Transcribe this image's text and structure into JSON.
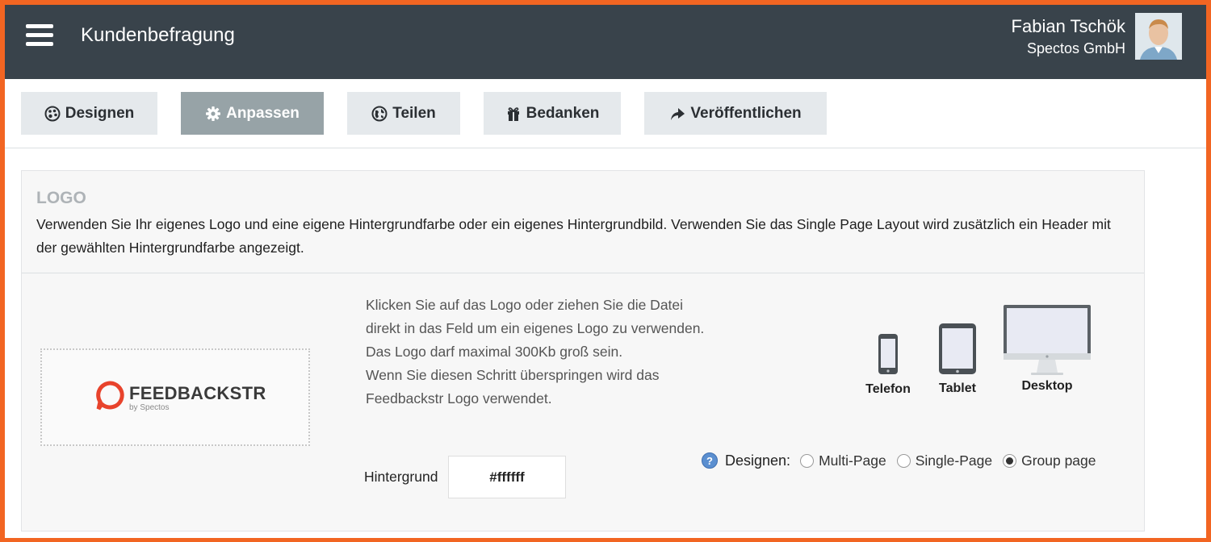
{
  "header": {
    "app_title": "Kundenbefragung",
    "user_name": "Fabian Tschök",
    "user_company": "Spectos GmbH"
  },
  "tabs": [
    {
      "label": "Designen",
      "icon": "palette-icon",
      "active": false
    },
    {
      "label": "Anpassen",
      "icon": "gear-icon",
      "active": true
    },
    {
      "label": "Teilen",
      "icon": "globe-icon",
      "active": false
    },
    {
      "label": "Bedanken",
      "icon": "gift-icon",
      "active": false
    },
    {
      "label": "Veröffentlichen",
      "icon": "publish-arrow-icon",
      "active": false
    }
  ],
  "logo_section": {
    "title": "LOGO",
    "description": "Verwenden Sie Ihr eigenes Logo und eine eigene Hintergrundfarbe oder ein eigenes Hintergrundbild. Verwenden Sie das Single Page Layout wird zusätzlich ein Header mit der gewählten Hintergrundfarbe angezeigt.",
    "logo_wordmark": "FEEDBACKSTR",
    "logo_tagline": "by Spectos",
    "instructions": [
      "Klicken Sie auf das Logo oder ziehen Sie die Datei direkt in das Feld um ein eigenes Logo zu verwenden.",
      "Das Logo darf maximal 300Kb groß sein.",
      "Wenn Sie diesen Schritt überspringen wird das Feedbackstr Logo verwendet."
    ],
    "background_label": "Hintergrund",
    "background_value": "#ffffff"
  },
  "devices": [
    {
      "label": "Telefon",
      "icon": "phone-icon"
    },
    {
      "label": "Tablet",
      "icon": "tablet-icon"
    },
    {
      "label": "Desktop",
      "icon": "desktop-icon"
    }
  ],
  "design_options": {
    "label": "Designen:",
    "options": [
      {
        "label": "Multi-Page",
        "checked": false
      },
      {
        "label": "Single-Page",
        "checked": false
      },
      {
        "label": "Group page",
        "checked": true
      }
    ]
  },
  "colors": {
    "header_bg": "#39434b",
    "active_tab": "#97a3a7",
    "tab_bg": "#e5e9ec",
    "frame_border": "#f26522",
    "logo_accent": "#e8432c"
  }
}
